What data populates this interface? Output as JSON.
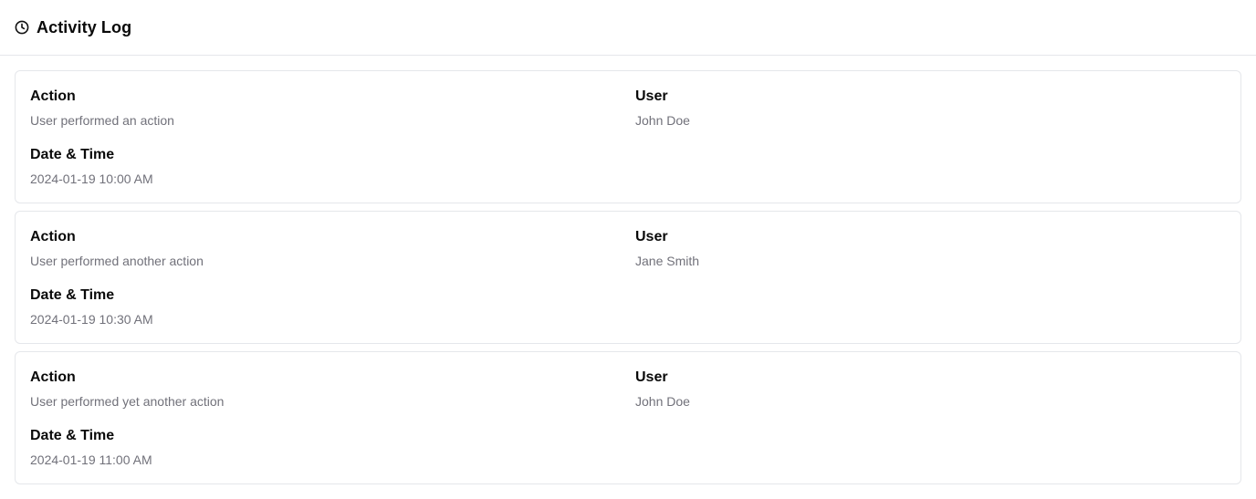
{
  "header": {
    "icon": "clock-icon",
    "title": "Activity Log"
  },
  "labels": {
    "action": "Action",
    "user": "User",
    "datetime": "Date & Time"
  },
  "entries": [
    {
      "action": "User performed an action",
      "user": "John Doe",
      "datetime": "2024-01-19 10:00 AM"
    },
    {
      "action": "User performed another action",
      "user": "Jane Smith",
      "datetime": "2024-01-19 10:30 AM"
    },
    {
      "action": "User performed yet another action",
      "user": "John Doe",
      "datetime": "2024-01-19 11:00 AM"
    }
  ]
}
